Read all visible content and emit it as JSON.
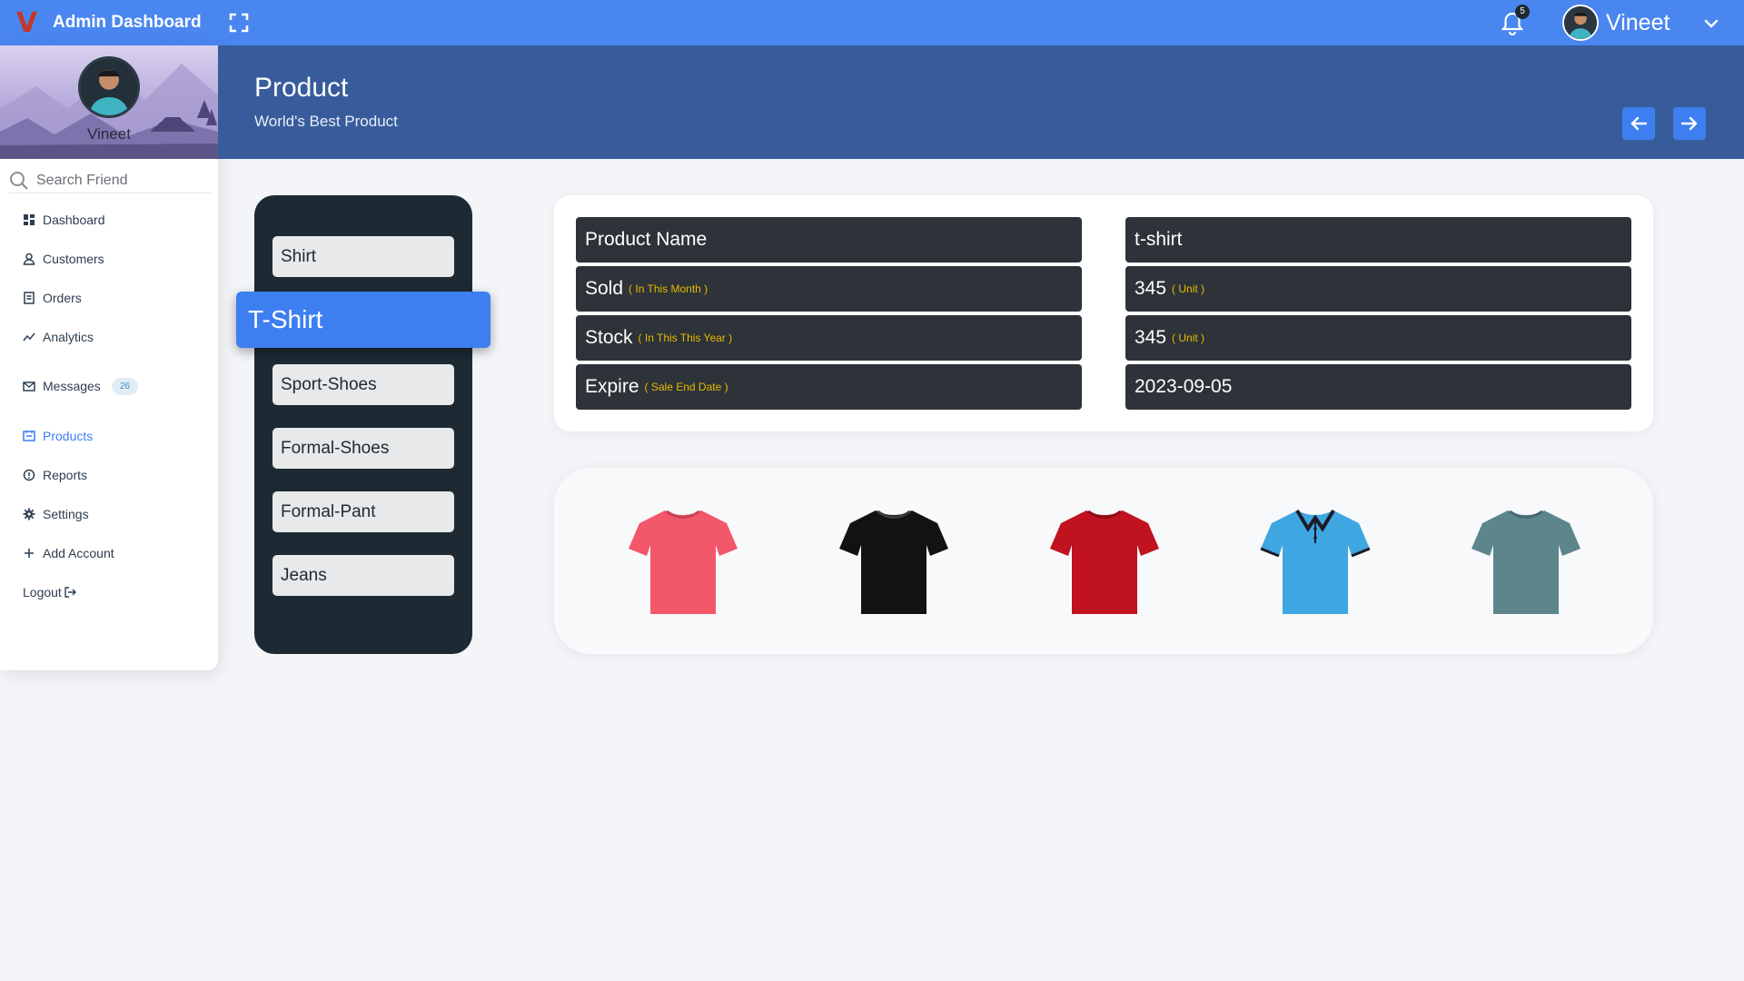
{
  "topbar": {
    "logo": "V",
    "title": "Admin Dashboard",
    "notifications": "5",
    "username": "Vineet"
  },
  "sidebar": {
    "profile_name": "Vineet",
    "search_placeholder": "Search Friend",
    "items": [
      {
        "label": "Dashboard",
        "icon": "dashboard-icon"
      },
      {
        "label": "Customers",
        "icon": "user-icon"
      },
      {
        "label": "Orders",
        "icon": "orders-icon"
      },
      {
        "label": "Analytics",
        "icon": "analytics-icon"
      },
      {
        "label": "Messages",
        "icon": "mail-icon",
        "badge": "26"
      },
      {
        "label": "Products",
        "icon": "products-icon",
        "active": true
      },
      {
        "label": "Reports",
        "icon": "reports-icon"
      },
      {
        "label": "Settings",
        "icon": "gear-icon"
      },
      {
        "label": "Add Account",
        "icon": "plus-icon"
      },
      {
        "label": "Logout",
        "icon": "logout-icon"
      }
    ]
  },
  "header": {
    "title": "Product",
    "subtitle": "World's Best Product"
  },
  "categories": [
    "Shirt",
    "T-Shirt",
    "Sport-Shoes",
    "Formal-Shoes",
    "Formal-Pant",
    "Jeans"
  ],
  "active_category": "T-Shirt",
  "details": {
    "rows": [
      {
        "label": "Product Name",
        "label_note": "",
        "value": "t-shirt",
        "value_note": ""
      },
      {
        "label": "Sold",
        "label_note": "( In This Month )",
        "value": "345",
        "value_note": "( Unit )"
      },
      {
        "label": "Stock",
        "label_note": "( In This This Year )",
        "value": "345",
        "value_note": "( Unit )"
      },
      {
        "label": "Expire",
        "label_note": "( Sale End Date )",
        "value": "2023-09-05",
        "value_note": ""
      }
    ]
  },
  "gallery": {
    "items": [
      {
        "name": "pink-tshirt",
        "color": "#f2576a"
      },
      {
        "name": "black-tshirt",
        "color": "#121212"
      },
      {
        "name": "red-tshirt",
        "color": "#c0121f"
      },
      {
        "name": "blue-polo",
        "color": "#3ea6e0"
      },
      {
        "name": "teal-tshirt",
        "color": "#5d858c"
      }
    ]
  },
  "colors": {
    "topbar": "#4a86f0",
    "header": "#385c9b",
    "accent": "#3d7ff0",
    "panel_dark": "#1d2a33",
    "note_yellow": "#e7b900"
  }
}
